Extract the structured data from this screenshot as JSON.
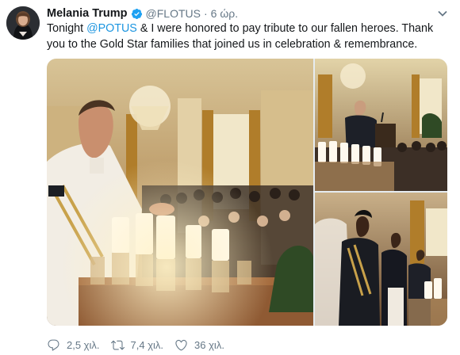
{
  "tweet": {
    "display_name": "Melania Trump",
    "handle": "@FLOTUS",
    "separator": "·",
    "time": "6 ώρ.",
    "text_parts": {
      "before": "Tonight ",
      "mention": "@POTUS",
      "after": " & I were honored to pay tribute to our fallen heroes.  Thank you to the Gold Star families that joined us in celebration & remembrance."
    }
  },
  "actions": {
    "reply_count": "2,5 χιλ.",
    "retweet_count": "7,4 χιλ.",
    "like_count": "36 χιλ."
  },
  "icons": {
    "verified": "verified-badge-icon",
    "caret": "chevron-down-icon",
    "reply": "reply-icon",
    "retweet": "retweet-icon",
    "like": "heart-icon"
  },
  "colors": {
    "link": "#1b95e0",
    "muted": "#657786",
    "text": "#14171a"
  }
}
